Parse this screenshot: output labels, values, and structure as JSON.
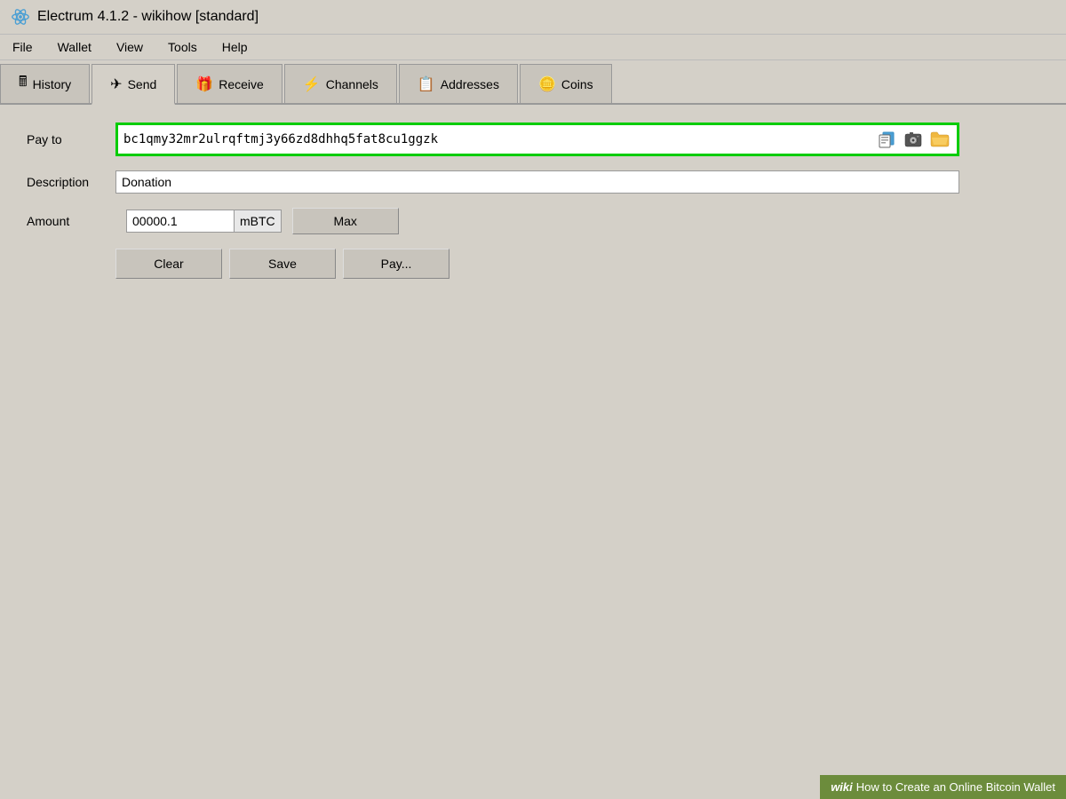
{
  "titleBar": {
    "appName": "Electrum 4.1.2",
    "separator": "-",
    "walletName": "wikihow",
    "walletType": "[standard]"
  },
  "menuBar": {
    "items": [
      "File",
      "Wallet",
      "View",
      "Tools",
      "Help"
    ]
  },
  "tabs": [
    {
      "id": "history",
      "label": "History",
      "icon": "🖩",
      "active": false
    },
    {
      "id": "send",
      "label": "Send",
      "icon": "✈",
      "active": true
    },
    {
      "id": "receive",
      "label": "Receive",
      "icon": "🎁",
      "active": false
    },
    {
      "id": "channels",
      "label": "Channels",
      "icon": "⚡",
      "active": false
    },
    {
      "id": "addresses",
      "label": "Addresses",
      "icon": "📋",
      "active": false
    },
    {
      "id": "coins",
      "label": "Coins",
      "icon": "🪙",
      "active": false
    }
  ],
  "form": {
    "payToLabel": "Pay to",
    "payToValue": "bc1qmy32mr2ulrqftmj3y66zd8dhhq5fat8cu1ggzk",
    "descriptionLabel": "Description",
    "descriptionValue": "Donation",
    "amountLabel": "Amount",
    "amountValue": "00000.1",
    "amountUnit": "mBTC"
  },
  "buttons": {
    "max": "Max",
    "clear": "Clear",
    "save": "Save",
    "pay": "Pay..."
  },
  "icons": {
    "copy": "📋",
    "camera": "📷",
    "folder": "📁"
  },
  "wikihow": {
    "wikiPart": "wiki",
    "howText": "How to Create an Online Bitcoin Wallet"
  }
}
